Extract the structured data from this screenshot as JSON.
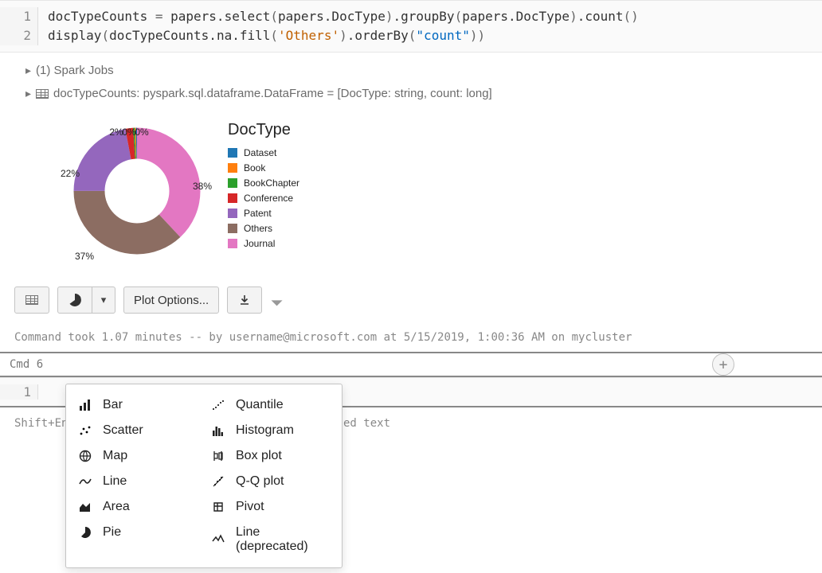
{
  "code": {
    "lines": [
      "docTypeCounts = papers.select(papers.DocType).groupBy(papers.DocType).count()",
      "display(docTypeCounts.na.fill('Others').orderBy(\"count\"))"
    ]
  },
  "output": {
    "spark_jobs": "(1) Spark Jobs",
    "schema_line": "docTypeCounts:  pyspark.sql.dataframe.DataFrame = [DocType: string, count: long]"
  },
  "chart_data": {
    "type": "pie",
    "title": "DocType",
    "categories": [
      "Dataset",
      "Book",
      "BookChapter",
      "Conference",
      "Patent",
      "Others",
      "Journal"
    ],
    "values_pct": [
      0.3,
      0.3,
      0.4,
      2,
      22,
      37,
      38
    ],
    "visible_labels": [
      "2%",
      "0%",
      "0%",
      "22%",
      "37%",
      "38%"
    ],
    "colors": {
      "Dataset": "#1f77b4",
      "Book": "#ff7f0e",
      "BookChapter": "#2ca02c",
      "Conference": "#d62728",
      "Patent": "#9467bd",
      "Others": "#8c6d62",
      "Journal": "#e377c2"
    }
  },
  "toolbar": {
    "plot_options": "Plot Options..."
  },
  "footer": {
    "text": "Command took 1.07 minutes -- by username@microsoft.com at 5/15/2019, 1:00:36 AM on mycluster"
  },
  "cmd_bar": {
    "label": "Cmd 6"
  },
  "hint": {
    "text": "Shift+Enter to run    Shift+Ctrl+Enter to run selected text"
  },
  "menu": {
    "col1": [
      "Bar",
      "Scatter",
      "Map",
      "Line",
      "Area",
      "Pie"
    ],
    "col2": [
      "Quantile",
      "Histogram",
      "Box plot",
      "Q-Q plot",
      "Pivot",
      "Line (deprecated)"
    ]
  }
}
